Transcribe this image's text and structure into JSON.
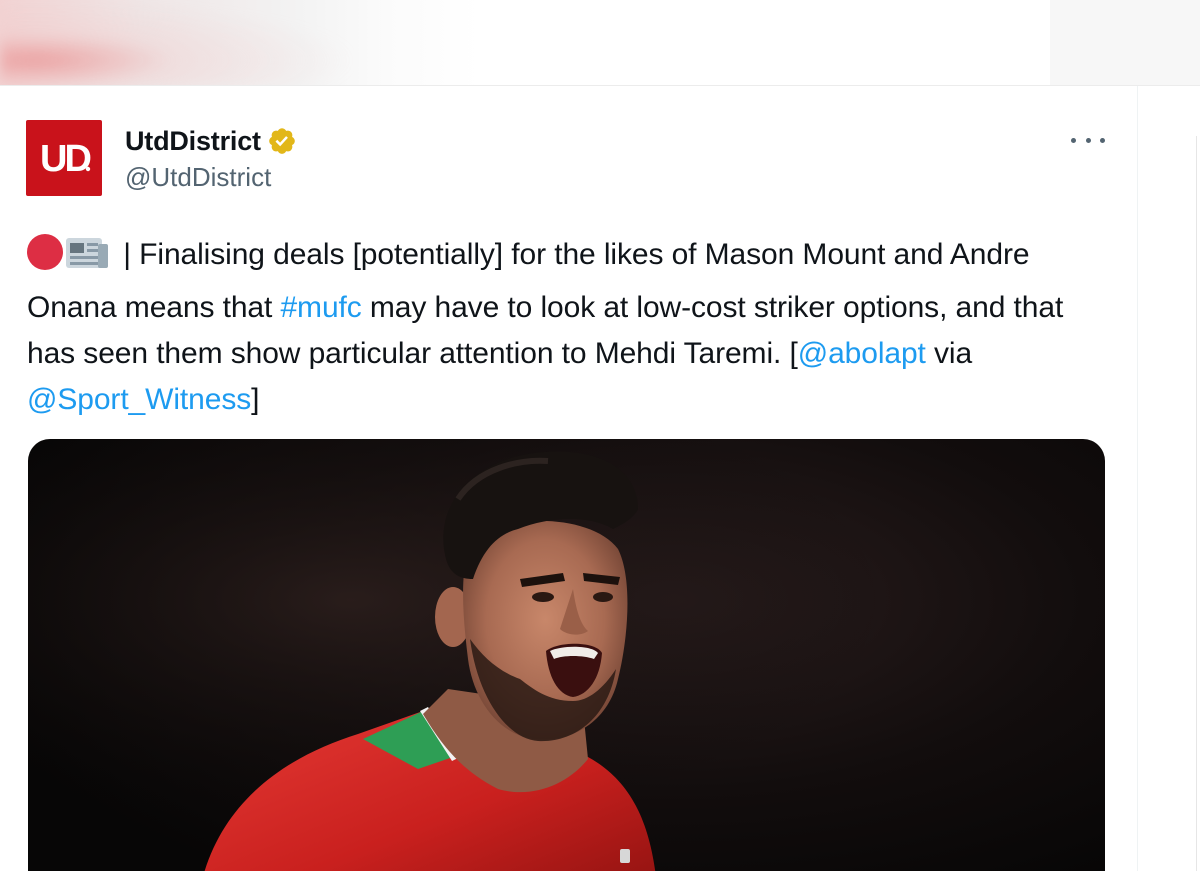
{
  "tweet": {
    "author": {
      "display_name": "UtdDistrict",
      "handle": "@UtdDistrict",
      "verified": true,
      "avatar_text": "UD"
    },
    "text_parts": [
      {
        "type": "text",
        "value": " | Finalising deals [potentially] for the likes of Mason Mount and Andre Onana means that "
      },
      {
        "type": "link",
        "value": "#mufc"
      },
      {
        "type": "text",
        "value": " may have to look at low-cost striker options, and that has seen them show particular attention to Mehdi Taremi. ["
      },
      {
        "type": "link",
        "value": "@abolapt"
      },
      {
        "type": "text",
        "value": " via "
      },
      {
        "type": "link",
        "value": "@Sport_Witness"
      },
      {
        "type": "text",
        "value": "]"
      }
    ],
    "emojis": [
      "red-circle",
      "newspaper"
    ],
    "media": {
      "kind": "photo"
    }
  },
  "colors": {
    "avatar_bg": "#c9121b",
    "link": "#1d9bf0",
    "text": "#0f1419",
    "secondary": "#536471",
    "verified_gold": "#e2b719",
    "red_circle": "#dd2e44"
  },
  "icons": {
    "more": "more-horizontal-icon",
    "verified": "verified-badge-icon"
  }
}
